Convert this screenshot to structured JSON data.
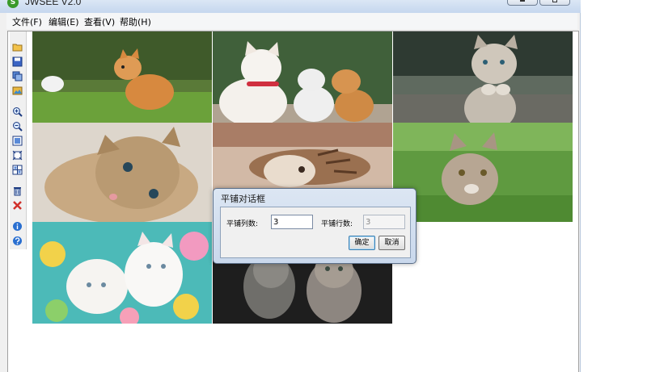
{
  "window": {
    "title": "JWSEE V2.0",
    "app_icon": "S",
    "caption_buttons": [
      "minimize-icon",
      "maximize-icon"
    ]
  },
  "menu": [
    {
      "label": "文件(F)"
    },
    {
      "label": "编辑(E)"
    },
    {
      "label": "查看(V)"
    },
    {
      "label": "帮助(H)"
    }
  ],
  "toolbar": [
    {
      "icon": "open-folder-icon"
    },
    {
      "icon": "save-icon"
    },
    {
      "icon": "copy-icon"
    },
    {
      "icon": "image-open-icon"
    },
    {
      "icon": "zoom-in-icon"
    },
    {
      "icon": "zoom-out-icon"
    },
    {
      "icon": "fit-window-icon"
    },
    {
      "icon": "actual-size-icon"
    },
    {
      "icon": "tile-icon"
    },
    {
      "icon": "delete-icon"
    },
    {
      "icon": "close-red-x-icon"
    },
    {
      "icon": "info-icon"
    },
    {
      "icon": "help-icon"
    }
  ],
  "dialog": {
    "title": "平铺对话框",
    "cols_label": "平铺列数:",
    "cols_value": "3",
    "rows_label": "平铺行数:",
    "rows_value": "3",
    "ok_label": "确定",
    "cancel_label": "取消"
  },
  "tiles": [
    {
      "subject": "kitten-on-grass-photo"
    },
    {
      "subject": "three-cats-photo"
    },
    {
      "subject": "grey-kitten-paws-photo"
    },
    {
      "subject": "tabby-kitten-lying-photo"
    },
    {
      "subject": "sleeping-kittens-photo"
    },
    {
      "subject": "kitten-in-grass-photo"
    },
    {
      "subject": "white-kittens-candy-photo"
    },
    {
      "subject": "two-kittens-dark-photo"
    }
  ],
  "colors": {
    "accent": "#3c7fb1",
    "delete": "#d0302a",
    "info": "#2a6fd0"
  }
}
